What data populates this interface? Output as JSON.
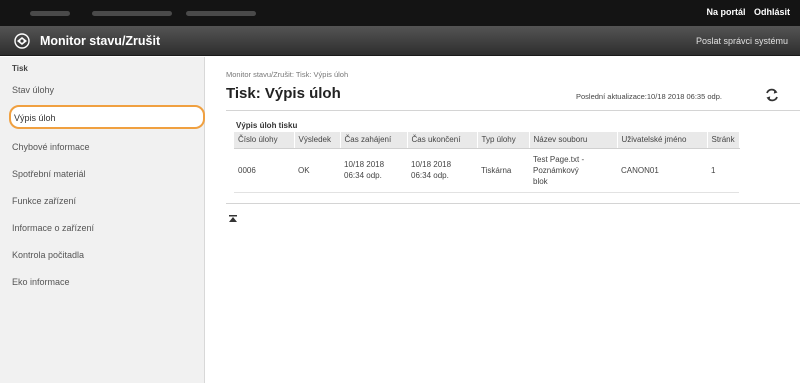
{
  "topbar": {
    "portal_link": "Na portál",
    "logout_link": "Odhlásit"
  },
  "header": {
    "title": "Monitor stavu/Zrušit",
    "send_mail_link": "Poslat správci systému"
  },
  "sidebar": {
    "section": "Tisk",
    "items": [
      {
        "label": "Stav úlohy"
      },
      {
        "label": "Výpis úloh"
      },
      {
        "label": "Chybové informace"
      },
      {
        "label": "Spotřební materiál"
      },
      {
        "label": "Funkce zařízení"
      },
      {
        "label": "Informace o zařízení"
      },
      {
        "label": "Kontrola počitadla"
      },
      {
        "label": "Eko informace"
      }
    ]
  },
  "main": {
    "breadcrumb": "Monitor stavu/Zrušit: Tisk: Výpis úloh",
    "title": "Tisk: Výpis úloh",
    "last_update": "Poslední aktualizace:10/18 2018 06:35 odp.",
    "table_title": "Výpis úloh tisku",
    "columns": [
      "Číslo úlohy",
      "Výsledek",
      "Čas zahájení",
      "Čas ukončení",
      "Typ úlohy",
      "Název souboru",
      "Uživatelské jméno",
      "Stránk"
    ],
    "rows": [
      {
        "job_number": "0006",
        "result": "OK",
        "start_date": "10/18 2018",
        "start_time": "06:34 odp.",
        "end_date": "10/18 2018",
        "end_time": "06:34 odp.",
        "job_type": "Tiskárna",
        "file_line1": "Test Page.txt -",
        "file_line2": "Poznámkový",
        "file_line3": "blok",
        "user": "CANON01",
        "pages": "1"
      }
    ]
  }
}
